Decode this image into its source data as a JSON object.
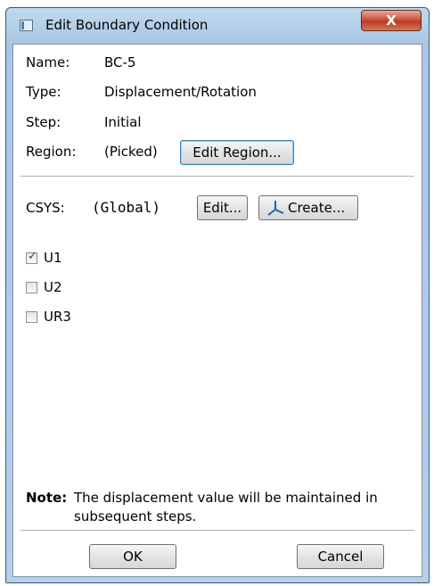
{
  "window": {
    "title": "Edit Boundary Condition",
    "close_label": "X"
  },
  "fields": {
    "name_label": "Name:",
    "name_value": "BC-5",
    "type_label": "Type:",
    "type_value": "Displacement/Rotation",
    "step_label": "Step:",
    "step_value": "Initial",
    "region_label": "Region:",
    "region_value": "(Picked)",
    "edit_region_label": "Edit Region..."
  },
  "csys": {
    "label": "CSYS:",
    "value": "(Global)",
    "edit_label": "Edit...",
    "create_label": "Create..."
  },
  "dofs": [
    {
      "label": "U1",
      "checked": true
    },
    {
      "label": "U2",
      "checked": false
    },
    {
      "label": "UR3",
      "checked": false
    }
  ],
  "note": {
    "label": "Note:",
    "text": "The displacement value will be maintained in subsequent steps."
  },
  "buttons": {
    "ok_label": "OK",
    "cancel_label": "Cancel"
  }
}
